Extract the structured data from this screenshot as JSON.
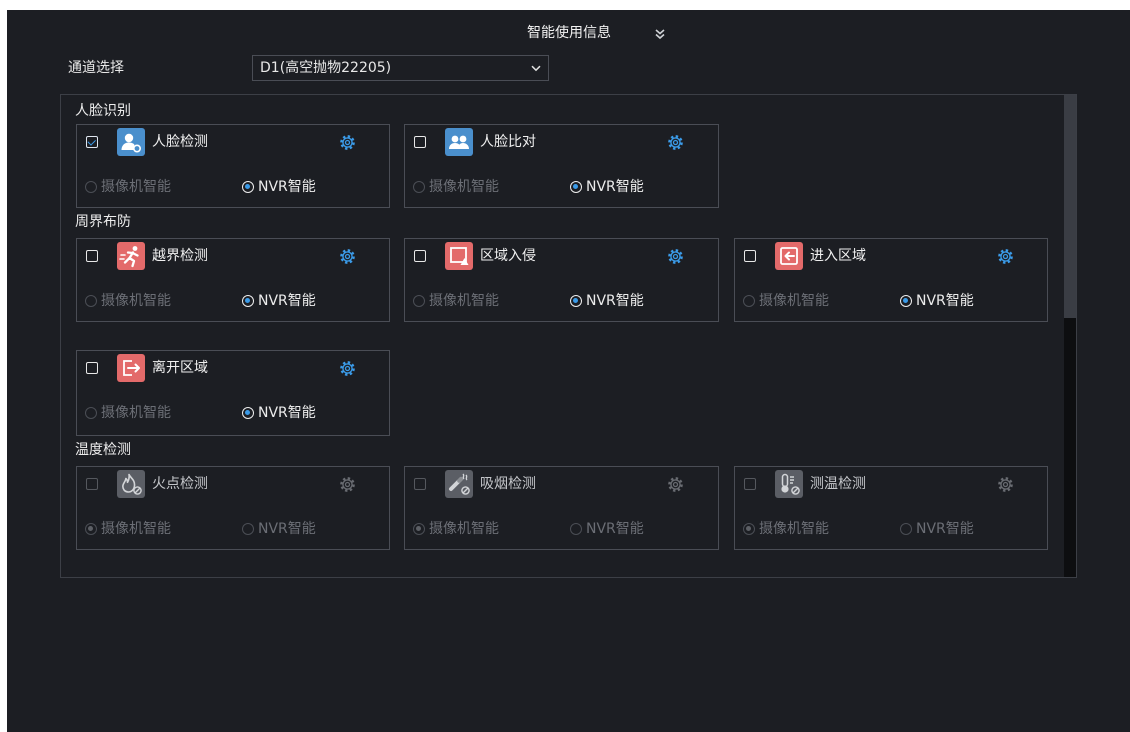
{
  "header": {
    "title": "智能使用信息",
    "toggle_icon": "double-chevron-down-icon"
  },
  "channel_select": {
    "label": "通道选择",
    "value": "D1(高空抛物22205)",
    "icon": "chevron-down-icon"
  },
  "settings_icon": "gear-icon",
  "colors": {
    "bg": "#1c1e23",
    "accent": "#3b9be8",
    "face_icon": "#4a8fcc",
    "perimeter_icon": "#e36a6a",
    "disabled_icon": "#5b5e65"
  },
  "sections": [
    {
      "title": "人脸识别",
      "cards": [
        {
          "label": "人脸检测",
          "icon": "face-detection-icon",
          "checked": true,
          "enabled": true,
          "options": [
            {
              "label": "摄像机智能",
              "selected": false,
              "enabled": false
            },
            {
              "label": "NVR智能",
              "selected": true,
              "enabled": true
            }
          ]
        },
        {
          "label": "人脸比对",
          "icon": "face-comparison-icon",
          "checked": false,
          "enabled": true,
          "options": [
            {
              "label": "摄像机智能",
              "selected": false,
              "enabled": false
            },
            {
              "label": "NVR智能",
              "selected": true,
              "enabled": true
            }
          ]
        }
      ]
    },
    {
      "title": "周界布防",
      "cards": [
        {
          "label": "越界检测",
          "icon": "line-crossing-icon",
          "checked": false,
          "enabled": true,
          "options": [
            {
              "label": "摄像机智能",
              "selected": false,
              "enabled": false
            },
            {
              "label": "NVR智能",
              "selected": true,
              "enabled": true
            }
          ]
        },
        {
          "label": "区域入侵",
          "icon": "area-intrusion-icon",
          "checked": false,
          "enabled": true,
          "options": [
            {
              "label": "摄像机智能",
              "selected": false,
              "enabled": false
            },
            {
              "label": "NVR智能",
              "selected": true,
              "enabled": true
            }
          ]
        },
        {
          "label": "进入区域",
          "icon": "enter-area-icon",
          "checked": false,
          "enabled": true,
          "options": [
            {
              "label": "摄像机智能",
              "selected": false,
              "enabled": false
            },
            {
              "label": "NVR智能",
              "selected": true,
              "enabled": true
            }
          ]
        },
        {
          "label": "离开区域",
          "icon": "leave-area-icon",
          "checked": false,
          "enabled": true,
          "options": [
            {
              "label": "摄像机智能",
              "selected": false,
              "enabled": false
            },
            {
              "label": "NVR智能",
              "selected": true,
              "enabled": true
            }
          ]
        }
      ]
    },
    {
      "title": "温度检测",
      "cards": [
        {
          "label": "火点检测",
          "icon": "fire-detection-icon",
          "checked": false,
          "enabled": false,
          "options": [
            {
              "label": "摄像机智能",
              "selected": true,
              "enabled": false
            },
            {
              "label": "NVR智能",
              "selected": false,
              "enabled": false
            }
          ]
        },
        {
          "label": "吸烟检测",
          "icon": "smoking-detection-icon",
          "checked": false,
          "enabled": false,
          "options": [
            {
              "label": "摄像机智能",
              "selected": true,
              "enabled": false
            },
            {
              "label": "NVR智能",
              "selected": false,
              "enabled": false
            }
          ]
        },
        {
          "label": "测温检测",
          "icon": "temperature-measurement-icon",
          "checked": false,
          "enabled": false,
          "options": [
            {
              "label": "摄像机智能",
              "selected": true,
              "enabled": false
            },
            {
              "label": "NVR智能",
              "selected": false,
              "enabled": false
            }
          ]
        }
      ]
    }
  ]
}
